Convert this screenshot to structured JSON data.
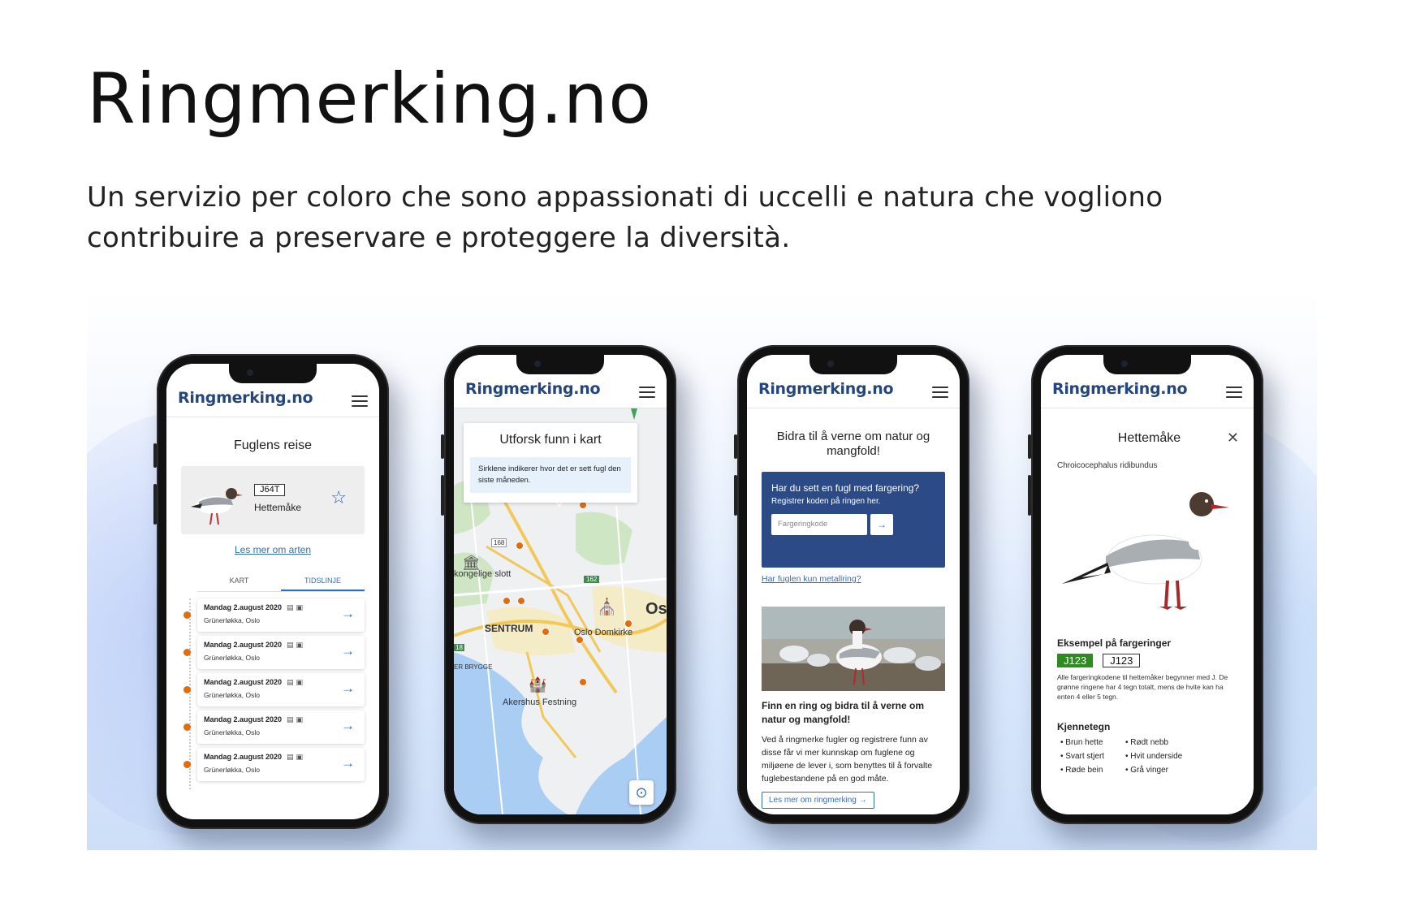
{
  "page": {
    "title": "Ringmerking.no",
    "subtitle": "Un servizio per coloro che sono appassionati di uccelli e natura che vogliono contribuire a preservare e proteggere la diversità."
  },
  "app": {
    "logo": "Ringmerking.no"
  },
  "phone1": {
    "title": "Fuglens reise",
    "ring_code": "J64T",
    "species": "Hettemåke",
    "link": "Les mer om arten",
    "tabs": [
      "KART",
      "TIDSLINJE"
    ],
    "active_tab": "TIDSLINJE",
    "timeline": [
      {
        "date": "Mandag 2.august 2020",
        "place": "Grünerløkka, Oslo"
      },
      {
        "date": "Mandag 2.august 2020",
        "place": "Grünerløkka, Oslo"
      },
      {
        "date": "Mandag 2.august 2020",
        "place": "Grünerløkka, Oslo"
      },
      {
        "date": "Mandag 2.august 2020",
        "place": "Grünerløkka, Oslo"
      },
      {
        "date": "Mandag 2.august 2020",
        "place": "Grünerløkka, Oslo"
      }
    ]
  },
  "phone2": {
    "title": "Utforsk funn i kart",
    "info": "Sirklene indikerer hvor det er sett fugl den siste måneden.",
    "labels": {
      "slott": "kongelige slott",
      "sentrum": "SENTRUM",
      "domkirke": "Oslo Domkirke",
      "os": "Os",
      "brygge": "ER BRYGGE",
      "akershus": "Akershus Festning",
      "r168": "168",
      "r162": "162",
      "r18": "18"
    }
  },
  "phone3": {
    "title": "Bidra til å verne om natur og mangfold!",
    "card_question": "Har du sett en fugl med fargering?",
    "card_sub": "Registrer koden på ringen her.",
    "input_placeholder": "Fargeringkode",
    "metal_link": "Har fuglen kun metallring?",
    "article_title": "Finn en ring og bidra til å verne om natur og mangfold!",
    "article_body": "Ved å ringmerke fugler og registrere funn av disse får vi mer kunnskap om fuglene og miljøene de lever i, som benyttes til å forvalte fuglebestandene på en god måte.",
    "read_more": "Les mer om ringmerking"
  },
  "phone4": {
    "title": "Hettemåke",
    "latin": "Chroicocephalus ridibundus",
    "examples_title": "Eksempel på fargeringer",
    "ring_green": "J123",
    "ring_white": "J123",
    "note": "Alle fargeringkodene til hettemåker begynner med J. De grønne ringene har 4 tegn totalt, mens de hvite kan ha enten 4 eller 5 tegn.",
    "traits_title": "Kjennetegn",
    "traits": [
      "Brun hette",
      "Rødt nebb",
      "Svart stjert",
      "Hvit underside",
      "Røde bein",
      "Grå vinger"
    ]
  },
  "colors": {
    "brand": "#25467d",
    "accent": "#2f6fbf",
    "dot": "#e06c10",
    "ring_green": "#2e8b1f"
  }
}
